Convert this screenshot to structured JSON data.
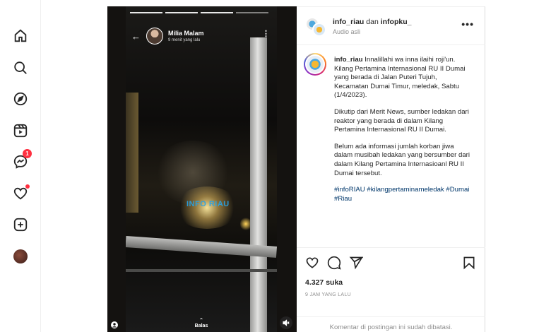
{
  "nav": {
    "items": [
      {
        "name": "home",
        "icon": "home-icon"
      },
      {
        "name": "search",
        "icon": "search-icon"
      },
      {
        "name": "explore",
        "icon": "compass-icon"
      },
      {
        "name": "reels",
        "icon": "reels-icon"
      },
      {
        "name": "messages",
        "icon": "messenger-icon",
        "badge": "1"
      },
      {
        "name": "notifications",
        "icon": "heart-icon"
      },
      {
        "name": "create",
        "icon": "plus-square-icon"
      },
      {
        "name": "profile",
        "icon": "avatar"
      }
    ]
  },
  "media": {
    "story_user": "Milia Malam",
    "story_time": "9 menit yang lalu",
    "watermark": "INFO RIAU",
    "reply_label": "Balas"
  },
  "post": {
    "header": {
      "user1": "info_riau",
      "connector": " dan ",
      "user2": "infopku_",
      "audio": "Audio asli"
    },
    "caption": {
      "user": "info_riau",
      "p1": "Innalillahi wa inna ilaihi roji'un. Kilang Pertamina Internasional RU II Dumai yang berada di Jalan Puteri Tujuh, Kecamatan Dumai Timur, meledak, Sabtu (1/4/2023).",
      "p2": "Dikutip dari Merit News, sumber ledakan dari reaktor yang berada di dalam Kilang Pertamina Internasional RU II Dumai.",
      "p3": "Belum ada informasi jumlah korban jiwa dalam musibah ledakan yang bersumber dari dalam Kilang Pertamina Internasioanl RU II Dumai tersebut.",
      "tags": "#infoRIAU #kilangpertaminameledak #Dumai #Riau"
    },
    "likes": "4.327 suka",
    "posted": "9 JAM YANG LALU",
    "comments_off": "Komentar di postingan ini sudah dibatasi."
  },
  "colors": {
    "accent_red": "#ff3040",
    "link": "#00376b",
    "muted": "#8e8e8e"
  }
}
